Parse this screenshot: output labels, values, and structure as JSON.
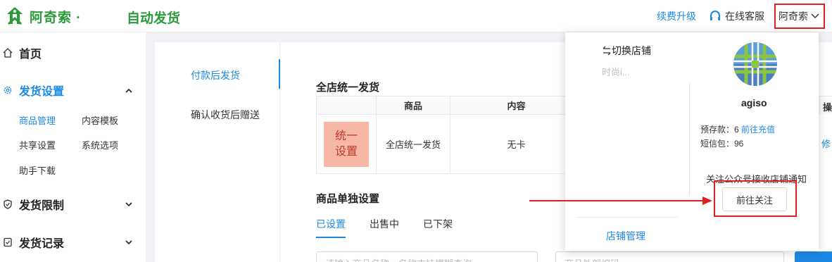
{
  "header": {
    "brand": "阿奇索 ·",
    "app_title": "自动发货",
    "renew_label": "续费升级",
    "service_label": "在线客服",
    "user_label": "阿奇索"
  },
  "sidebar": {
    "home": "首页",
    "ship_settings": "发货设置",
    "sub_items": [
      "商品管理",
      "内容模板",
      "共享设置",
      "系统选项",
      "助手下载"
    ],
    "ship_limits": "发货限制",
    "ship_records": "发货记录"
  },
  "main": {
    "vtabs": [
      "付款后发货",
      "确认收货后赠送"
    ],
    "unified_title": "全店统一发货",
    "table": {
      "headers": [
        "",
        "商品",
        "内容"
      ],
      "row": {
        "badge_line1": "统一",
        "badge_line2": "设置",
        "product": "全店统一发货",
        "content": "无卡"
      }
    },
    "cut_header": "操",
    "cut_link": "修",
    "single_title": "商品单独设置",
    "htabs": [
      "已设置",
      "出售中",
      "已下架"
    ],
    "search_placeholder": "请输入商品名称，名称支持模糊查询",
    "search_placeholder2": "商品外部编码"
  },
  "panel": {
    "switch_shop": "切换店铺",
    "blur_text": "时尚i...",
    "shop_manage": "店铺管理",
    "username": "agiso",
    "balance_label": "预存款：6",
    "recharge_link": "前往充值",
    "sms_label": "短信包：96",
    "follow_tip": "关注公众号接收店铺通知",
    "follow_button": "前往关注"
  },
  "colors": {
    "brand_green": "#2c9a3c",
    "accent_blue": "#1e88e5",
    "highlight_red": "#e02020"
  }
}
